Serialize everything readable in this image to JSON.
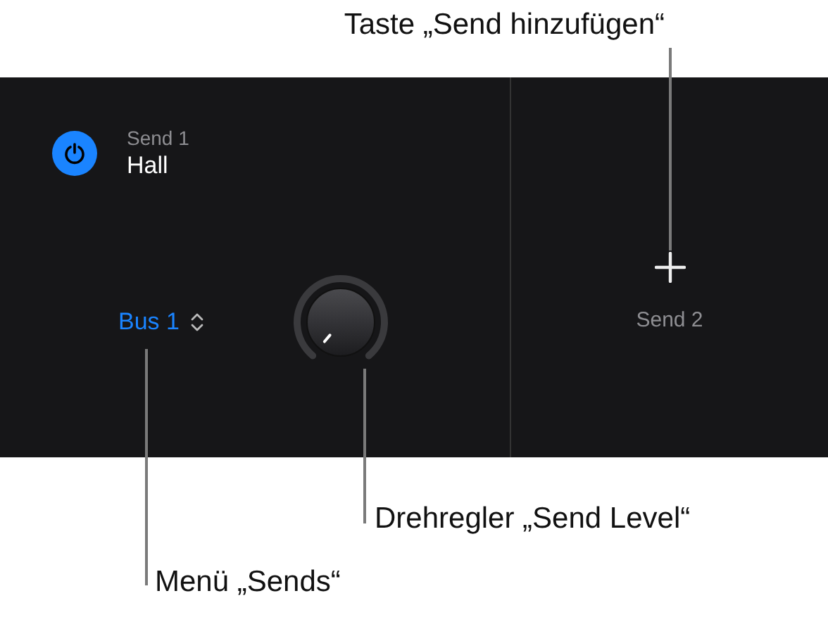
{
  "callouts": [
    {
      "kind": "top",
      "text": "Taste „Send hinzufügen“"
    },
    {
      "kind": "knob",
      "text": "Drehregler „Send Level“"
    },
    {
      "kind": "menu",
      "text": "Menü „Sends“"
    }
  ],
  "send_slot": {
    "on": true,
    "label": "Send 1",
    "name": "Hall",
    "bus": "Bus 1"
  },
  "empty_slot": {
    "label": "Send 2"
  }
}
